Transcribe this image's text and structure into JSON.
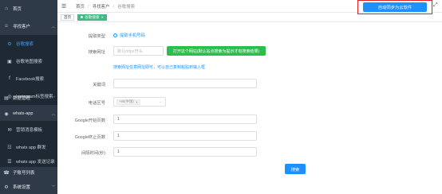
{
  "sidebar": {
    "items": [
      {
        "icon": "home-icon",
        "glyph": "⌂",
        "label": "首页",
        "chevron": ""
      },
      {
        "icon": "user-icon",
        "glyph": "☺",
        "label": "寻找客户",
        "chevron": "︿"
      },
      {
        "icon": "gear-icon",
        "glyph": "⚙",
        "label": "谷歌搜索",
        "chevron": ""
      },
      {
        "icon": "map-icon",
        "glyph": "▣",
        "label": "谷歌地图搜索",
        "chevron": ""
      },
      {
        "icon": "facebook-icon",
        "glyph": "f",
        "label": "Facebook搜索",
        "chevron": ""
      },
      {
        "icon": "instagram-icon",
        "glyph": "◎",
        "label": "Instagram标签搜索",
        "chevron": ""
      },
      {
        "icon": "database-icon",
        "glyph": "▤",
        "label": "数据管理",
        "chevron": "﹀"
      },
      {
        "icon": "whatsapp-icon",
        "glyph": "◉",
        "label": "whats-app",
        "chevron": "︿"
      },
      {
        "icon": "template-icon",
        "glyph": "✉",
        "label": "营销消息模板",
        "chevron": ""
      },
      {
        "icon": "group-icon",
        "glyph": "☷",
        "label": "whats app 群发",
        "chevron": ""
      },
      {
        "icon": "list-icon",
        "glyph": "☰",
        "label": "whats app 发送记录",
        "chevron": ""
      },
      {
        "icon": "phone-icon",
        "glyph": "☎",
        "label": "子账号列表",
        "chevron": ""
      },
      {
        "icon": "settings-icon",
        "glyph": "⚙",
        "label": "系统设置",
        "chevron": "﹀"
      }
    ]
  },
  "header": {
    "breadcrumb": [
      "首页",
      "寻找客户",
      "谷歌搜索"
    ],
    "sync_button": "自动同步为云软件"
  },
  "tags": [
    {
      "label": "首页",
      "active": false
    },
    {
      "label": "谷歌搜索",
      "active": true
    }
  ],
  "form": {
    "extract_type_label": "提取类型",
    "extract_type_value": "提取手机号码",
    "search_url_label": "搜索网址",
    "search_url_placeholder": "默认https开头",
    "open_tool_button": "打开这个网站(默认站点搜索为提示才有搜索结果)",
    "help_link": "搜索网址任意网址即可，可以自己复制粘贴到输入框",
    "keyword_label": "关键词",
    "area_code_label": "电话区号",
    "area_code_chip": "+86(中国)",
    "google_start_label": "Google开始页数",
    "google_start_value": "1",
    "google_end_label": "Google终止页数",
    "google_end_value": "1",
    "interval_label": "间隔时间(秒)",
    "interval_value": "1",
    "search_button": "搜索"
  }
}
